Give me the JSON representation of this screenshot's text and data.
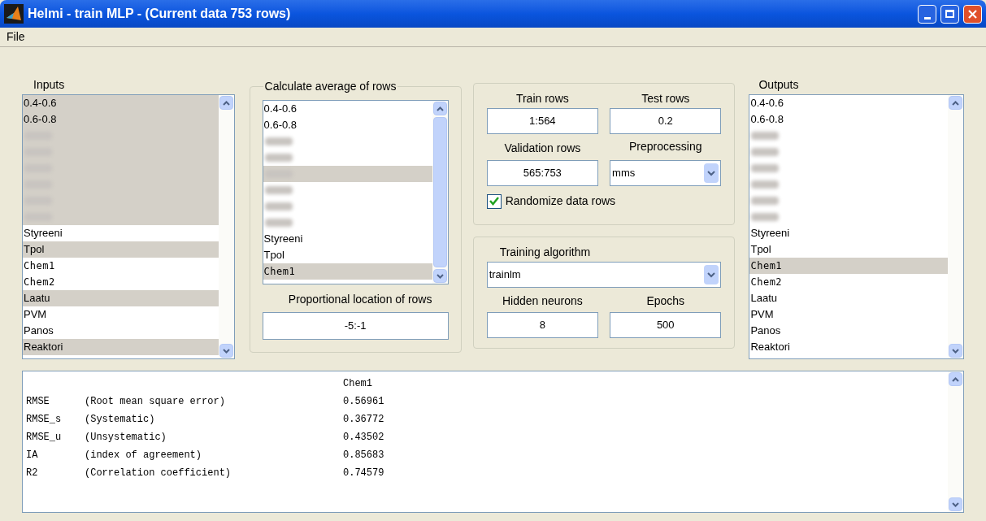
{
  "window": {
    "title": "Helmi - train MLP - (Current data 753 rows)"
  },
  "menu": [
    "File"
  ],
  "inputs": {
    "label": "Inputs",
    "items": [
      {
        "kind": "text",
        "label": "0.4-0.6",
        "selected": true
      },
      {
        "kind": "text",
        "label": "0.6-0.8",
        "selected": true
      },
      {
        "kind": "blurred",
        "selected": true
      },
      {
        "kind": "blurred",
        "selected": true
      },
      {
        "kind": "blurred",
        "selected": true
      },
      {
        "kind": "blurred",
        "selected": true
      },
      {
        "kind": "blurred",
        "selected": true
      },
      {
        "kind": "blurred",
        "selected": true
      },
      {
        "kind": "text",
        "label": "Styreeni",
        "selected": false
      },
      {
        "kind": "text",
        "label": "Tpol",
        "selected": true
      },
      {
        "kind": "code",
        "label": "Chem1",
        "selected": false
      },
      {
        "kind": "code",
        "label": "Chem2",
        "selected": false
      },
      {
        "kind": "text",
        "label": "Laatu",
        "selected": true
      },
      {
        "kind": "text",
        "label": "PVM",
        "selected": false
      },
      {
        "kind": "text",
        "label": "Panos",
        "selected": false
      },
      {
        "kind": "text",
        "label": "Reaktori",
        "selected": true
      }
    ]
  },
  "average": {
    "title": "Calculate average of rows",
    "items": [
      {
        "kind": "text",
        "label": "0.4-0.6",
        "selected": false
      },
      {
        "kind": "text",
        "label": "0.6-0.8",
        "selected": false
      },
      {
        "kind": "blurred",
        "selected": false
      },
      {
        "kind": "blurred",
        "selected": false
      },
      {
        "kind": "blurred",
        "selected": true
      },
      {
        "kind": "blurred",
        "selected": false
      },
      {
        "kind": "blurred",
        "selected": false
      },
      {
        "kind": "blurred",
        "selected": false
      },
      {
        "kind": "text",
        "label": "Styreeni",
        "selected": false
      },
      {
        "kind": "text",
        "label": "Tpol",
        "selected": false
      },
      {
        "kind": "code",
        "label": "Chem1",
        "selected": true
      }
    ],
    "location_label": "Proportional location of rows",
    "location": "-5:-1"
  },
  "rows_panel": {
    "train_label": "Train rows",
    "train": "1:564",
    "test_label": "Test rows",
    "test": "0.2",
    "validation_label": "Validation rows",
    "validation": "565:753",
    "preprocessing_label": "Preprocessing",
    "preprocessing": "mms",
    "randomize": {
      "label": "Randomize data rows",
      "checked": true
    }
  },
  "training_panel": {
    "algorithm_label": "Training algorithm",
    "algorithm": "trainlm",
    "hidden_label": "Hidden neurons",
    "hidden": "8",
    "epochs_label": "Epochs",
    "epochs": "500"
  },
  "outputs": {
    "label": "Outputs",
    "items": [
      {
        "kind": "text",
        "label": "0.4-0.6",
        "selected": false
      },
      {
        "kind": "text",
        "label": "0.6-0.8",
        "selected": false
      },
      {
        "kind": "blurred",
        "selected": false
      },
      {
        "kind": "blurred",
        "selected": false
      },
      {
        "kind": "blurred",
        "selected": false
      },
      {
        "kind": "blurred",
        "selected": false
      },
      {
        "kind": "blurred",
        "selected": false
      },
      {
        "kind": "blurred",
        "selected": false
      },
      {
        "kind": "text",
        "label": "Styreeni",
        "selected": false
      },
      {
        "kind": "text",
        "label": "Tpol",
        "selected": false
      },
      {
        "kind": "code",
        "label": "Chem1",
        "selected": true
      },
      {
        "kind": "code",
        "label": "Chem2",
        "selected": false
      },
      {
        "kind": "text",
        "label": "Laatu",
        "selected": false
      },
      {
        "kind": "text",
        "label": "PVM",
        "selected": false
      },
      {
        "kind": "text",
        "label": "Panos",
        "selected": false
      },
      {
        "kind": "text",
        "label": "Reaktori",
        "selected": false
      }
    ]
  },
  "results": {
    "column": "Chem1",
    "rows": [
      {
        "name": "RMSE",
        "description": "(Root mean square error)",
        "value": "0.56961"
      },
      {
        "name": "RMSE_s",
        "description": "(Systematic)",
        "value": "0.36772"
      },
      {
        "name": "RMSE_u",
        "description": "(Unsystematic)",
        "value": "0.43502"
      },
      {
        "name": "IA",
        "description": "(index of agreement)",
        "value": "0.85683"
      },
      {
        "name": "R2",
        "description": "(Correlation coefficient)",
        "value": "0.74579"
      }
    ]
  }
}
